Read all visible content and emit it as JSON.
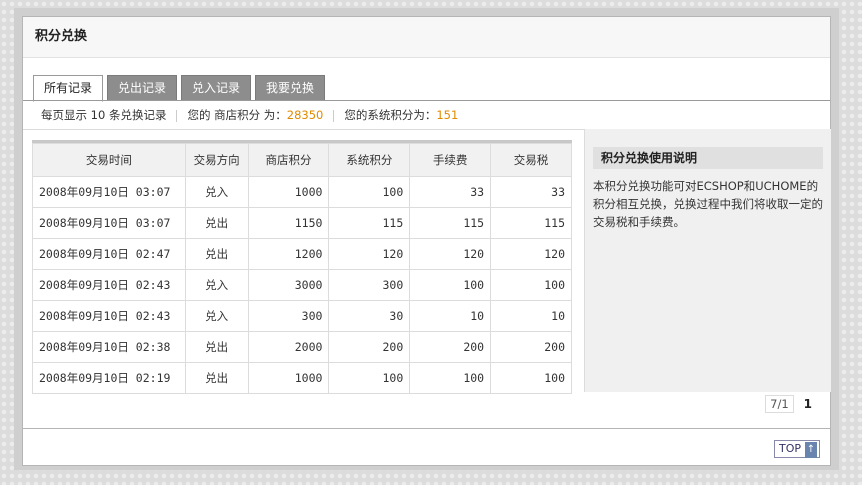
{
  "header": {
    "title": "积分兑换"
  },
  "tabs": [
    {
      "label": "所有记录",
      "active": true
    },
    {
      "label": "兑出记录",
      "active": false
    },
    {
      "label": "兑入记录",
      "active": false
    },
    {
      "label": "我要兑换",
      "active": false
    }
  ],
  "info": {
    "per_page_text": "每页显示 10 条兑换记录",
    "shop_points_label": "您的 商店积分 为：",
    "shop_points_value": "28350",
    "system_points_label": "您的系统积分为：",
    "system_points_value": "151"
  },
  "table": {
    "columns": [
      "交易时间",
      "交易方向",
      "商店积分",
      "系统积分",
      "手续费",
      "交易税"
    ],
    "rows": [
      [
        "2008年09月10日 03:07",
        "兑入",
        "1000",
        "100",
        "33",
        "33"
      ],
      [
        "2008年09月10日 03:07",
        "兑出",
        "1150",
        "115",
        "115",
        "115"
      ],
      [
        "2008年09月10日 02:47",
        "兑出",
        "1200",
        "120",
        "120",
        "120"
      ],
      [
        "2008年09月10日 02:43",
        "兑入",
        "3000",
        "300",
        "100",
        "100"
      ],
      [
        "2008年09月10日 02:43",
        "兑入",
        "300",
        "30",
        "10",
        "10"
      ],
      [
        "2008年09月10日 02:38",
        "兑出",
        "2000",
        "200",
        "200",
        "200"
      ],
      [
        "2008年09月10日 02:19",
        "兑出",
        "1000",
        "100",
        "100",
        "100"
      ]
    ]
  },
  "sidebar": {
    "title": "积分兑换使用说明",
    "text": "本积分兑换功能可对ECSHOP和UCHOME的积分相互兑换，兑换过程中我们将收取一定的交易税和手续费。"
  },
  "pager": {
    "info": "7/1",
    "current": "1"
  },
  "top_button": {
    "label": "TOP",
    "icon": "arrow-up-icon"
  }
}
